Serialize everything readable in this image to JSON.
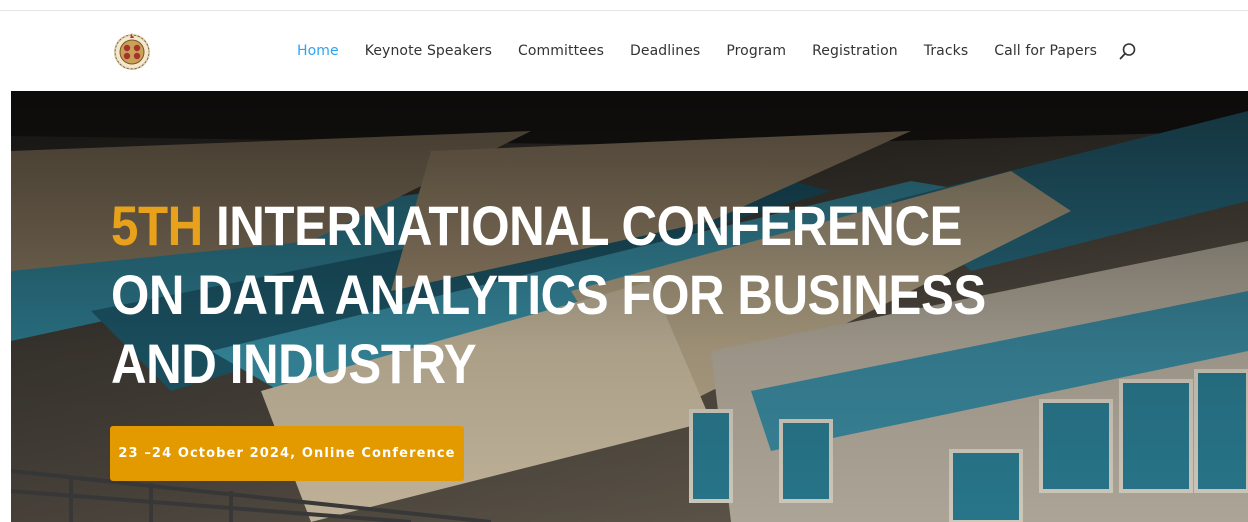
{
  "nav": {
    "items": [
      {
        "label": "Home",
        "active": true
      },
      {
        "label": "Keynote Speakers"
      },
      {
        "label": "Committees"
      },
      {
        "label": "Deadlines"
      },
      {
        "label": "Program"
      },
      {
        "label": "Registration"
      },
      {
        "label": "Tracks"
      },
      {
        "label": "Call for Papers"
      }
    ],
    "search_icon": "search-icon",
    "active_color": "#2ea3f2"
  },
  "hero": {
    "title_accent": "5TH",
    "title_rest": "INTERNATIONAL CONFERENCE ON DATA ANALYTICS FOR BUSINESS AND INDUSTRY",
    "cta_label": "23 –24 October 2024, Online Conference",
    "accent_color": "#e8a11a",
    "button_color": "#e39a00"
  }
}
